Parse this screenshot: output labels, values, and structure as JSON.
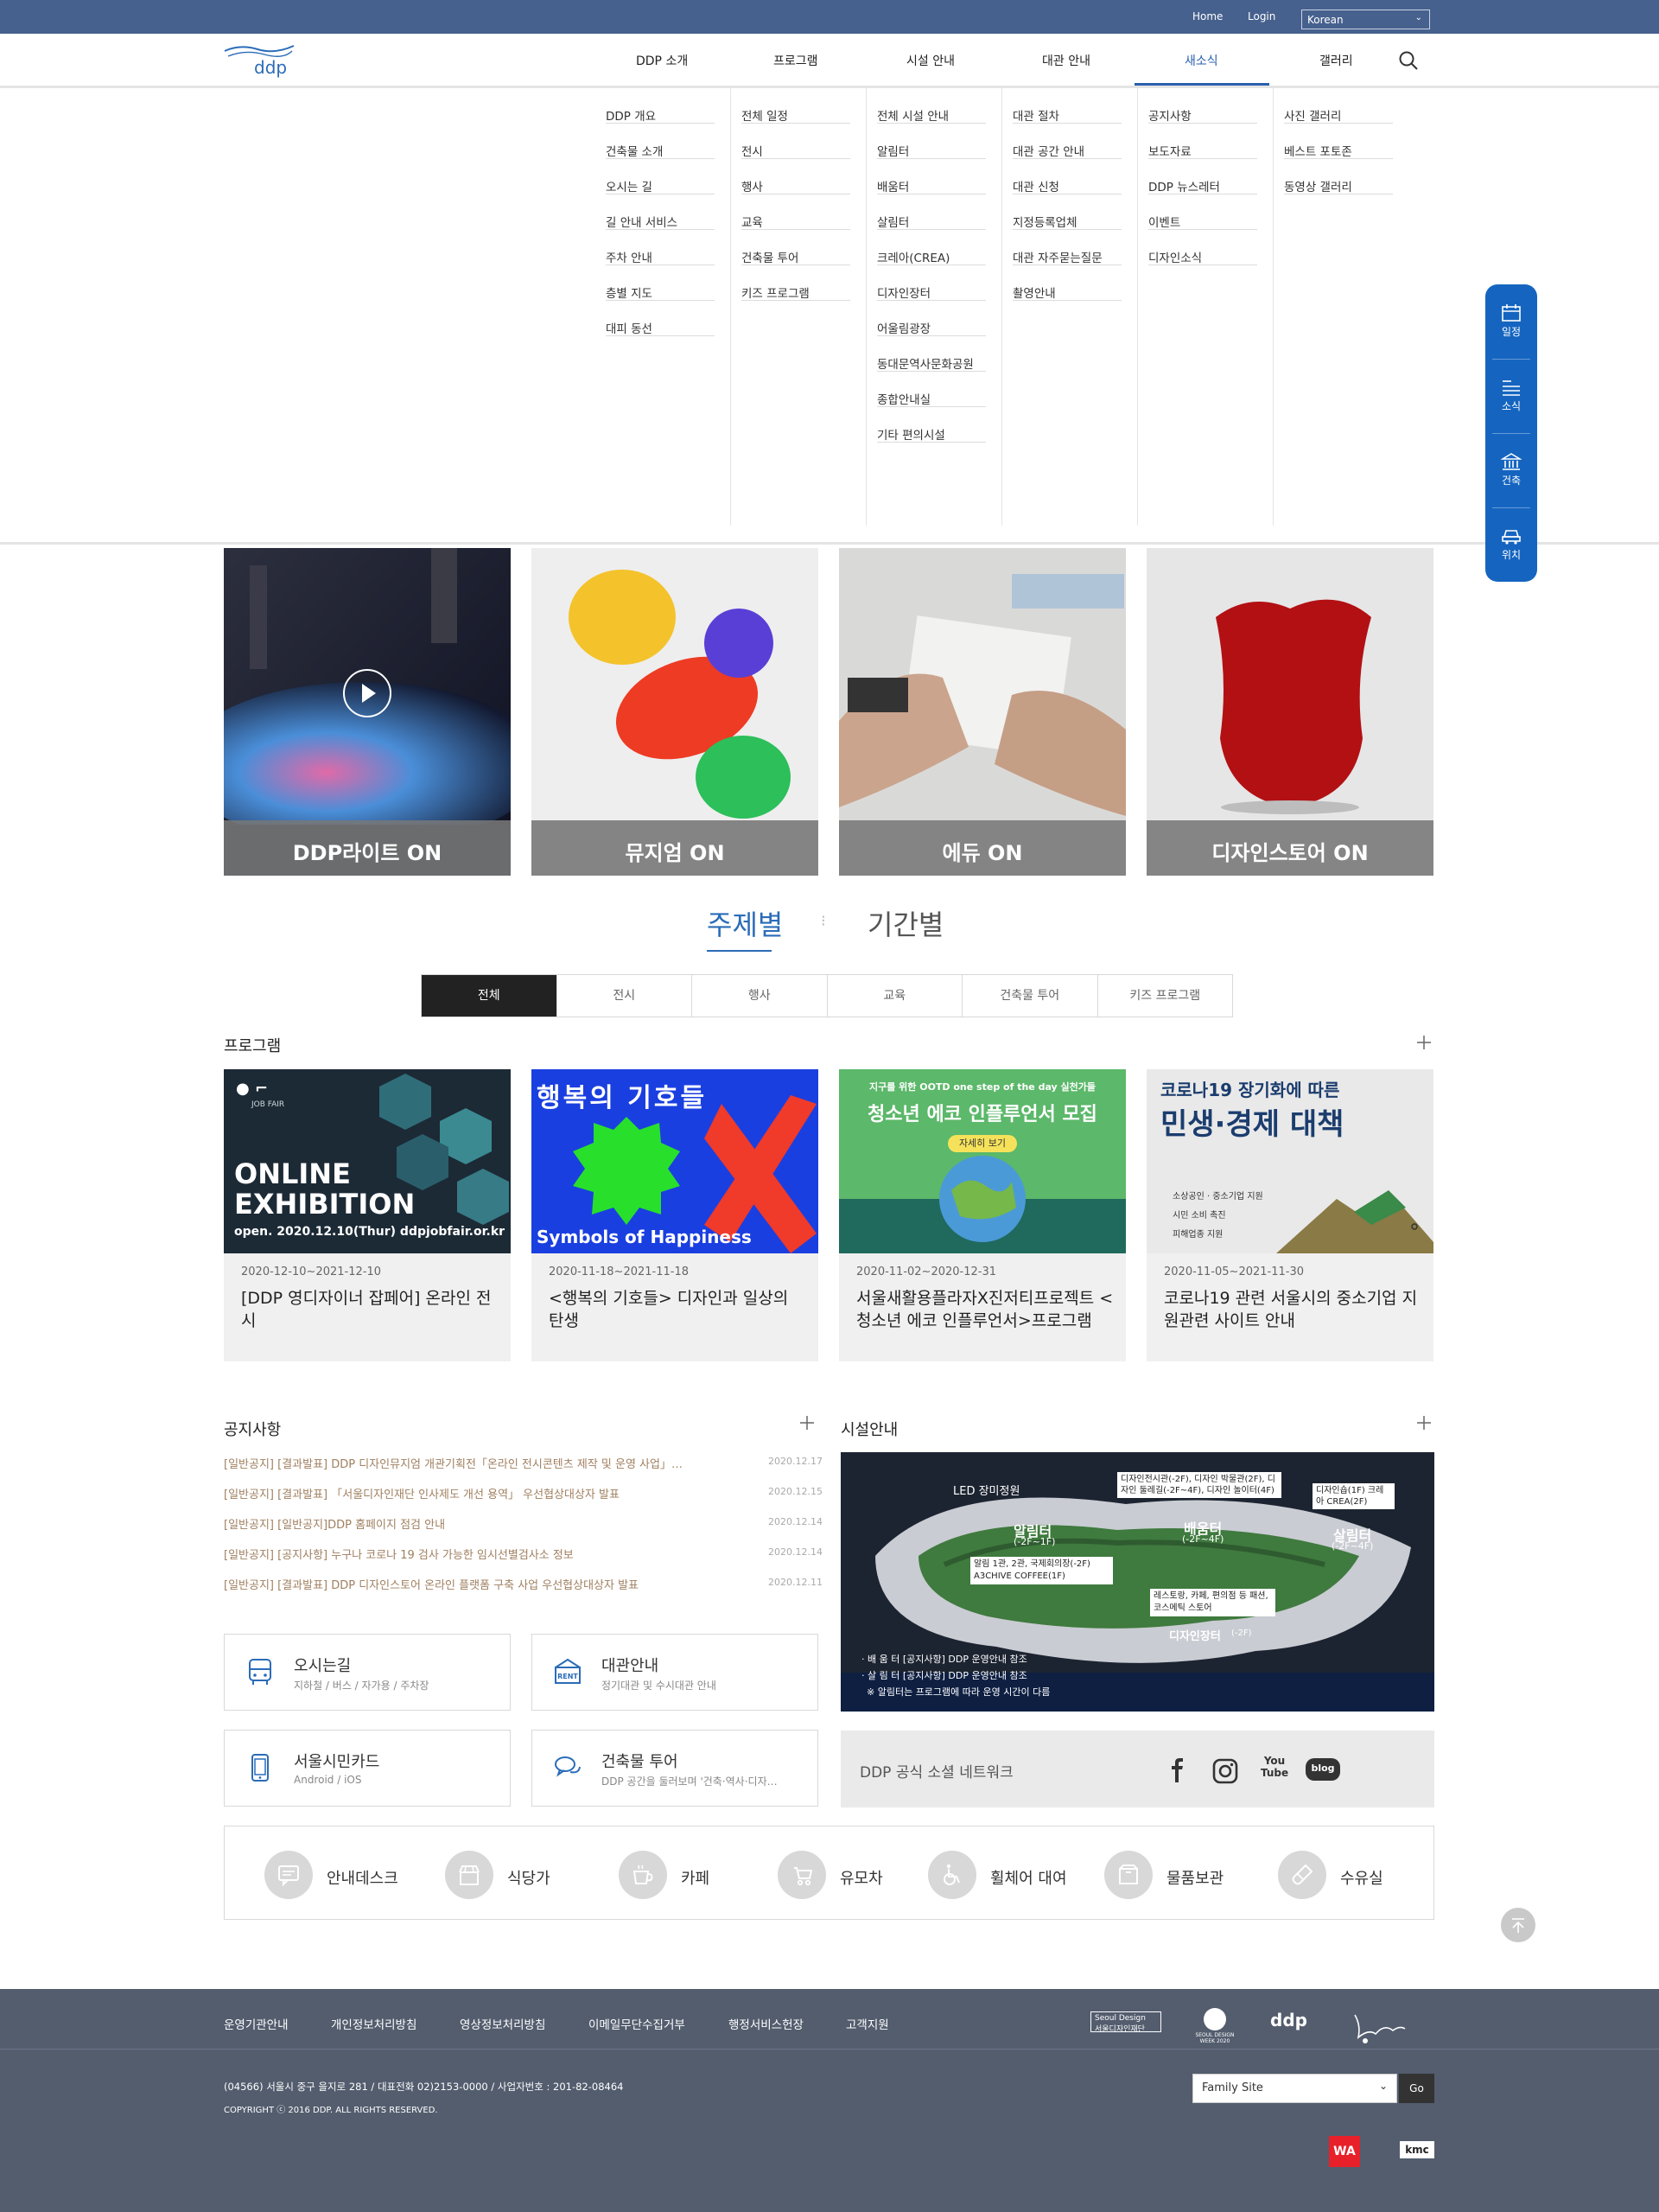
{
  "topbar": {
    "home": "Home",
    "login": "Login",
    "language": "Korean"
  },
  "nav": [
    "DDP 소개",
    "프로그램",
    "시설 안내",
    "대관 안내",
    "새소식",
    "갤러리"
  ],
  "mega_menu": [
    [
      "DDP 개요",
      "건축물 소개",
      "오시는 길",
      "길 안내 서비스",
      "주차 안내",
      "층별 지도",
      "대피 동선"
    ],
    [
      "전체 일정",
      "전시",
      "행사",
      "교육",
      "건축물 투어",
      "키즈 프로그램"
    ],
    [
      "전체 시설 안내",
      "알림터",
      "배움터",
      "살림터",
      "크레아(CREA)",
      "디자인장터",
      "어울림광장",
      "동대문역사문화공원",
      "종합안내실",
      "기타 편의시설"
    ],
    [
      "대관 절차",
      "대관 공간 안내",
      "대관 신청",
      "지정등록업체",
      "대관 자주묻는질문",
      "촬영안내"
    ],
    [
      "공지사항",
      "보도자료",
      "DDP 뉴스레터",
      "이벤트",
      "디자인소식"
    ],
    [
      "사진 갤러리",
      "베스트 포토존",
      "동영상 갤러리"
    ]
  ],
  "quick_menu": [
    "일정",
    "소식",
    "건축",
    "위치"
  ],
  "feature_cards": [
    "DDP라이트 ON",
    "뮤지엄 ON",
    "에듀 ON",
    "디자인스토어 ON"
  ],
  "view_tabs": {
    "by_topic": "주제별",
    "by_period": "기간별"
  },
  "category_tabs": [
    "전체",
    "전시",
    "행사",
    "교육",
    "건축물 투어",
    "키즈 프로그램"
  ],
  "program_section": {
    "title": "프로그램"
  },
  "programs": [
    {
      "date": "2020-12-10~2021-12-10",
      "title": "[DDP 영디자이너 잡페어] 온라인 전시",
      "img_lines": [
        "ONLINE",
        "EXHIBITION",
        "open. 2020.12.10(Thur)  ddpjobfair.or.kr"
      ],
      "img_tag": "JOB FAIR"
    },
    {
      "date": "2020-11-18~2021-11-18",
      "title": "<행복의 기호들> 디자인과 일상의 탄생",
      "img_lines": [
        "Symbols of Happiness"
      ]
    },
    {
      "date": "2020-11-02~2020-12-31",
      "title": "서울새활용플라자X진저티프로젝트 <청소년 에코 인플루언서>프로그램",
      "img_lines": [
        "지구를 위한 OOTD one step of the day 실천가들",
        "청소년 에코 인플루언서 모집",
        "자세히 보기"
      ]
    },
    {
      "date": "2020-11-05~2021-11-30",
      "title": "코로나19 관련 서울시의 중소기업 지원관련 사이트 안내",
      "img_lines": [
        "코로나19 장기화에 따른",
        "민생·경제 대책",
        "소상공인 · 중소기업 지원",
        "시민 소비 촉진",
        "피해업종 지원"
      ]
    }
  ],
  "notice_section": {
    "title": "공지사항"
  },
  "notices": [
    {
      "text": "[일반공지] [결과발표] DDP 디자인뮤지엄 개관기획전「온라인 전시콘텐츠 제작 및 운영 사업」…",
      "date": "2020.12.17"
    },
    {
      "text": "[일반공지] [결과발표] 「서울디자인재단 인사제도 개선 용역」 우선협상대상자 발표",
      "date": "2020.12.15"
    },
    {
      "text": "[일반공지] [일반공지]DDP 홈페이지 점검 안내",
      "date": "2020.12.14"
    },
    {
      "text": "[일반공지] [공지사항] 누구나 코로나 19 검사 가능한 임시선별검사소 정보",
      "date": "2020.12.14"
    },
    {
      "text": "[일반공지] [결과발표] DDP 디자인스토어 온라인 플랫폼 구축 사업 우선협상대상자 발표",
      "date": "2020.12.11"
    }
  ],
  "facility_section": {
    "title": "시설안내"
  },
  "facility_map_labels": {
    "led": "LED 장미정원",
    "allim": "알림터",
    "allim_floor": "(-2F~1F)",
    "baeum": "배움터",
    "baeum_floor": "(-2F~4F)",
    "salim": "살림터",
    "salim_floor": "(-2F~4F)",
    "baeum_desc": "디자인전시관(-2F), 디자인 박물관(2F), 디자인 둘레길(-2F~4F), 디자인 놀이터(4F)",
    "salim_desc": "디자인숍(1F) 크레아 CREA(2F)",
    "allim_desc": "알림 1관, 2관, 국제회의장(-2F) A3CHIVE COFFEE(1F)",
    "market_desc": "레스토랑, 카페, 편의점 등 패션,코스메틱 스토어",
    "market": "디자인장터",
    "market_floor": "(-2F)",
    "note1": "· 배 움 터   [공지사항] DDP 운영안내 참조",
    "note2": "· 살 림 터   [공지사항] DDP 운영안내 참조",
    "note3": "※ 알림터는 프로그램에 따라 운영 시간이 다름"
  },
  "info_boxes": [
    {
      "title": "오시는길",
      "sub": "지하철 / 버스 / 자가용 / 주차장",
      "icon": "bus-icon"
    },
    {
      "title": "대관안내",
      "sub": "정기대관 및 수시대관 안내",
      "icon": "rent-icon",
      "icon_text": "RENT"
    },
    {
      "title": "서울시민카드",
      "sub": "Android / iOS",
      "icon": "phone-icon"
    },
    {
      "title": "건축물 투어",
      "sub": "DDP 공간을 둘러보며 '건축·역사·디자…",
      "icon": "chat-icon"
    }
  ],
  "social": {
    "label": "DDP 공식 소셜 네트워크",
    "youtube_text": "You Tube",
    "blog_text": "blog"
  },
  "amenities": [
    "안내데스크",
    "식당가",
    "카페",
    "유모차",
    "휠체어 대여",
    "물품보관",
    "수유실"
  ],
  "footer": {
    "links": [
      "운영기관안내",
      "개인정보처리방침",
      "영상정보처리방침",
      "이메일무단수집거부",
      "행정서비스헌장",
      "고객지원"
    ],
    "address": "(04566) 서울시 중구 을지로 281 / 대표전화 02)2153-0000 / 사업자번호 : 201-82-08464",
    "copyright": "COPYRIGHT ⓒ 2016 DDP. ALL RIGHTS RESERVED.",
    "family_site": "Family Site",
    "go": "Go",
    "partner_logos": [
      "Seoul Design",
      "서울디자인재단",
      "SEOUL DESIGN WEEK 2020",
      "ddp",
      "WA",
      "kmc"
    ]
  },
  "colors": {
    "topbar": "#47618e",
    "accent": "#1565c0",
    "footer": "#535d6e"
  }
}
